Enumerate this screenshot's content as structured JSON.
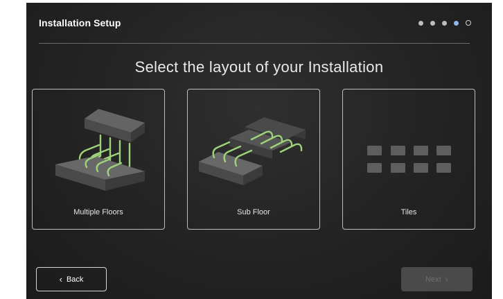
{
  "header": {
    "title": "Installation Setup",
    "steps_total": 5,
    "current_step": 4
  },
  "heading": "Select the layout of your Installation",
  "options": [
    {
      "label": "Multiple Floors",
      "icon": "multiple-floors-icon"
    },
    {
      "label": "Sub Floor",
      "icon": "sub-floor-icon"
    },
    {
      "label": "Tiles",
      "icon": "tiles-icon"
    }
  ],
  "nav": {
    "back_label": "Back",
    "next_label": "Next",
    "back_icon": "chevron-left-icon",
    "next_icon": "chevron-right-icon"
  },
  "colors": {
    "background": "#232323",
    "accent": "#8fb8ea",
    "wire": "#9fd37a",
    "block": "#5a5a5a"
  }
}
